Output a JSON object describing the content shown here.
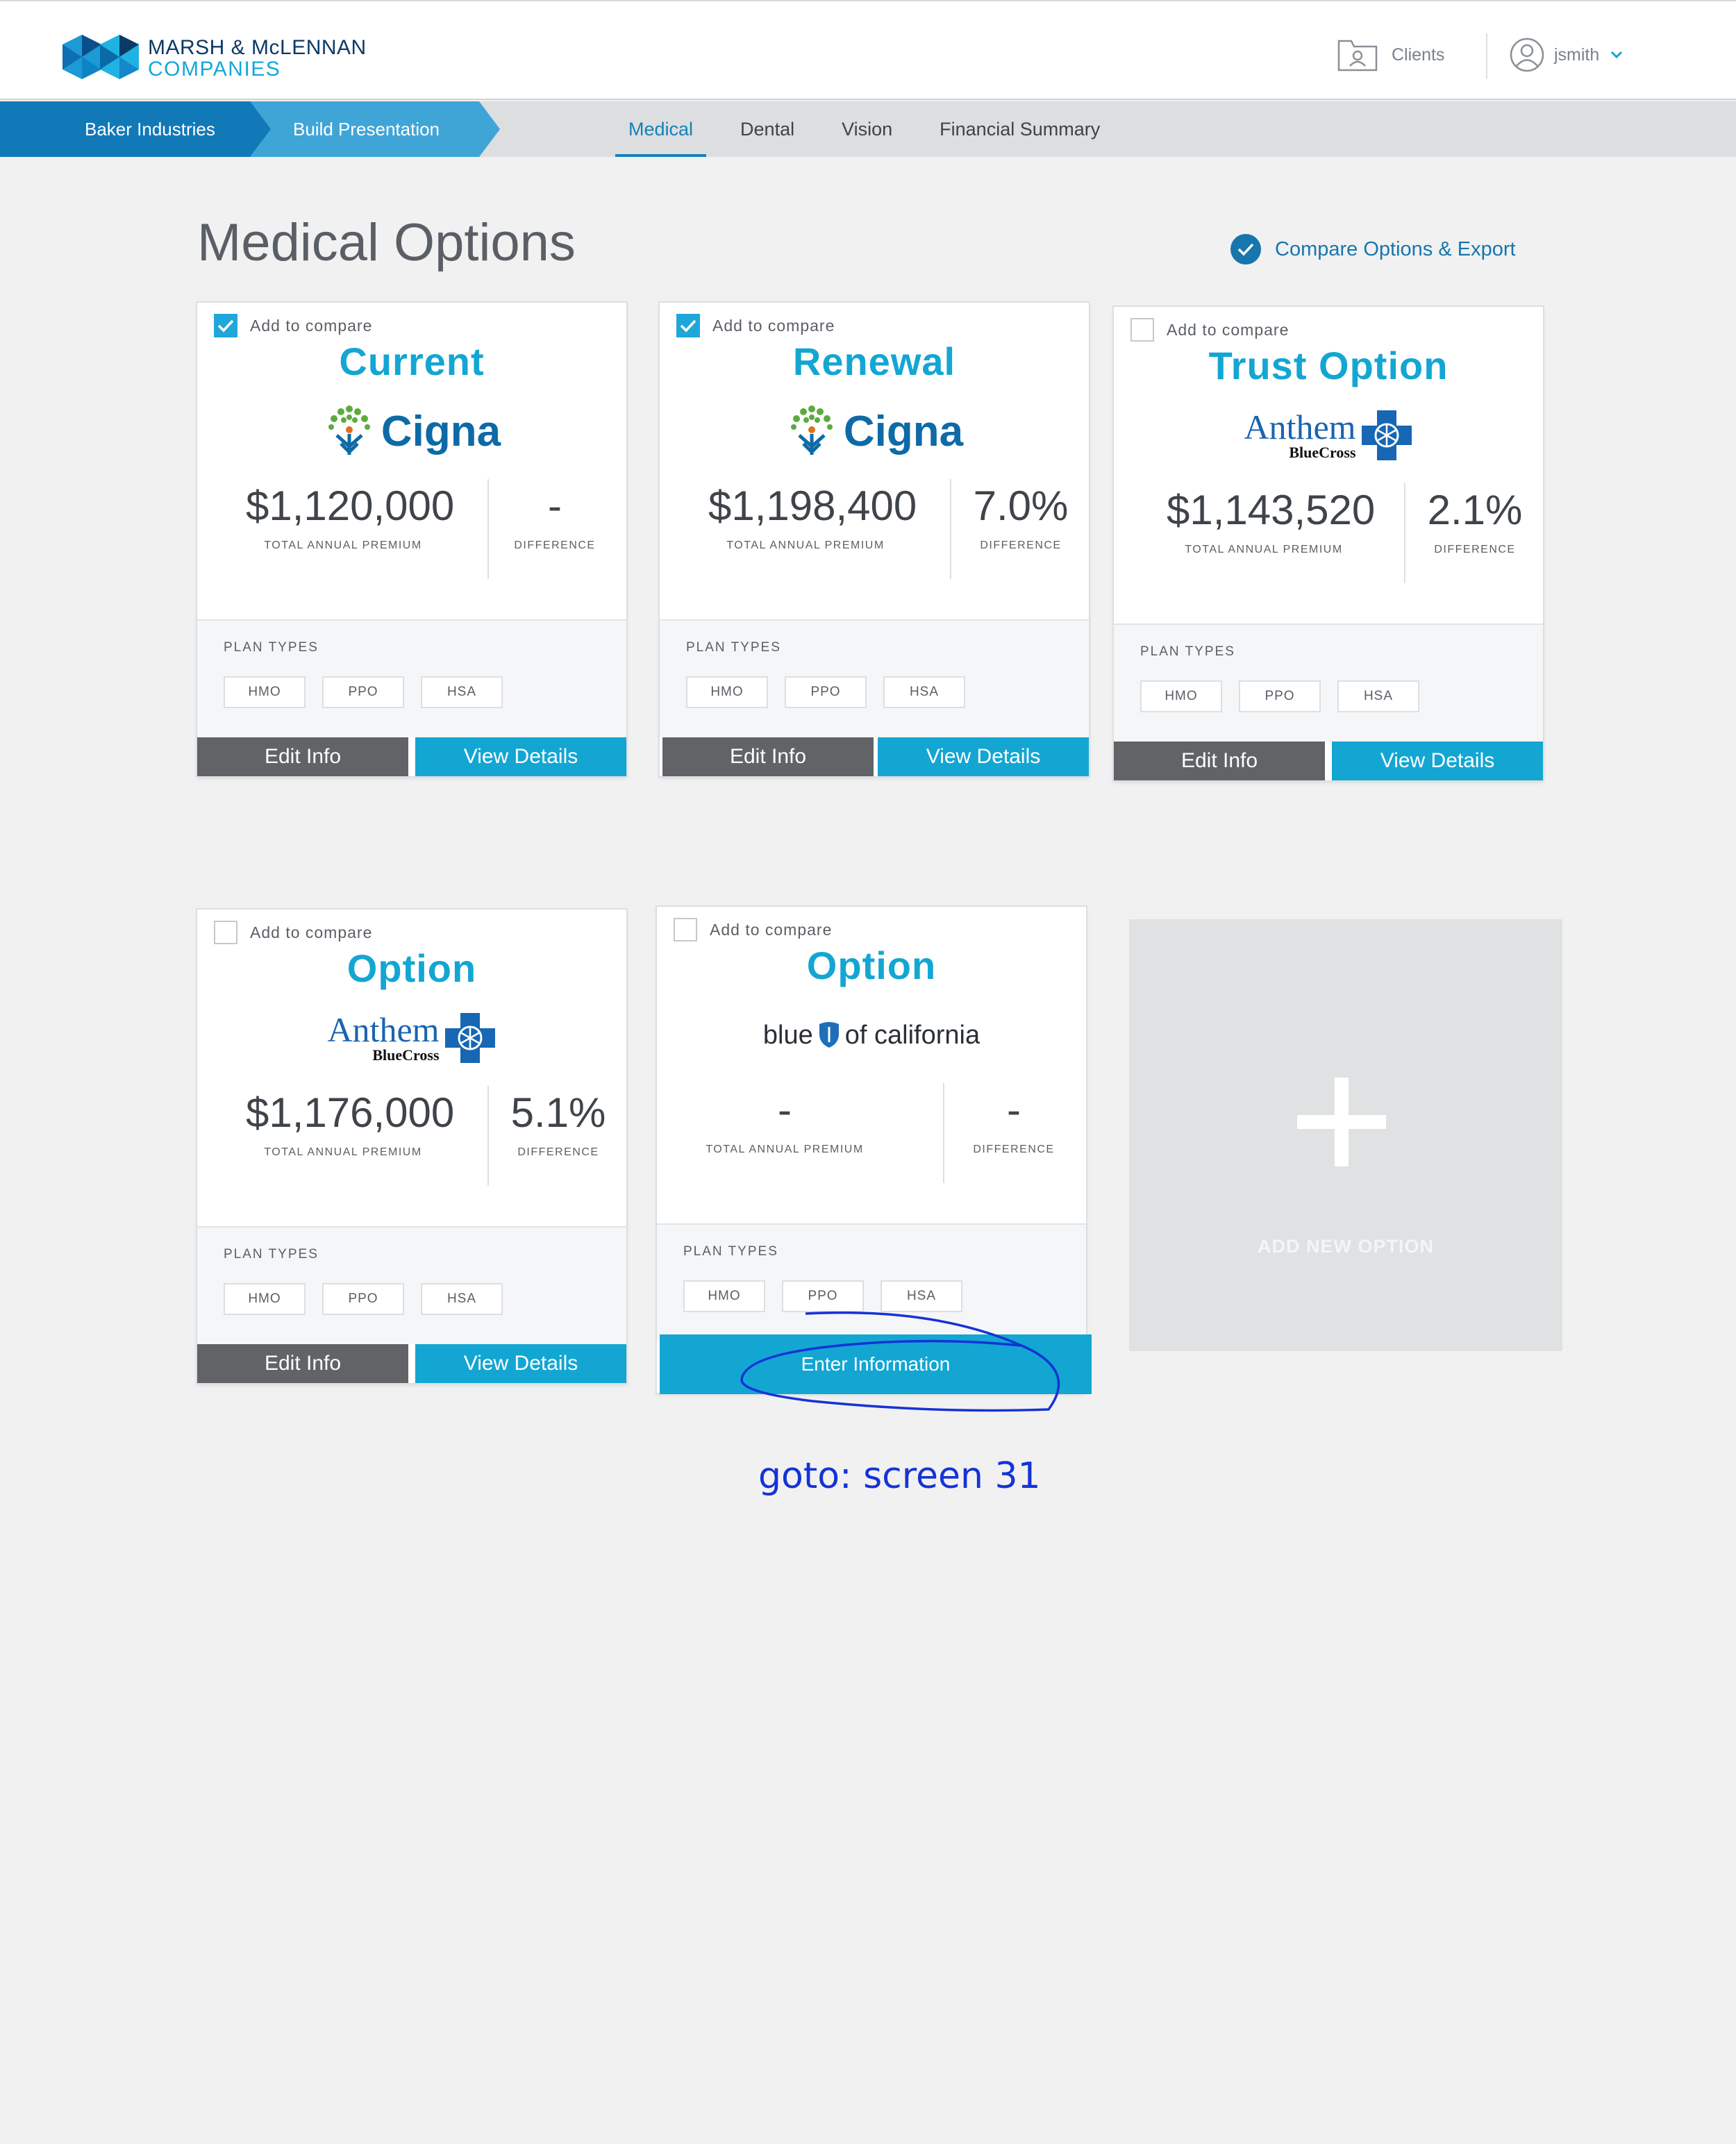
{
  "header": {
    "logo_line1": "MARSH & McLENNAN",
    "logo_line2": "COMPANIES",
    "clients_label": "Clients",
    "user_name": "jsmith"
  },
  "breadcrumb": {
    "items": [
      "Baker Industries",
      "Build Presentation"
    ]
  },
  "tabs": [
    {
      "label": "Medical",
      "active": true
    },
    {
      "label": "Dental",
      "active": false
    },
    {
      "label": "Vision",
      "active": false
    },
    {
      "label": "Financial Summary",
      "active": false
    }
  ],
  "page": {
    "title": "Medical Options",
    "compare_link": "Compare Options & Export"
  },
  "cards": [
    {
      "compare_label": "Add to compare",
      "checked": true,
      "title": "Current",
      "carrier": "Cigna",
      "premium": "$1,120,000",
      "premium_label": "TOTAL ANNUAL PREMIUM",
      "difference": "-",
      "difference_label": "DIFFERENCE",
      "plan_types_label": "PLAN TYPES",
      "plan_types": [
        "HMO",
        "PPO",
        "HSA"
      ],
      "edit_label": "Edit Info",
      "view_label": "View Details"
    },
    {
      "compare_label": "Add to compare",
      "checked": true,
      "title": "Renewal",
      "carrier": "Cigna",
      "premium": "$1,198,400",
      "premium_label": "TOTAL ANNUAL PREMIUM",
      "difference": "7.0%",
      "difference_label": "DIFFERENCE",
      "plan_types_label": "PLAN TYPES",
      "plan_types": [
        "HMO",
        "PPO",
        "HSA"
      ],
      "edit_label": "Edit Info",
      "view_label": "View Details"
    },
    {
      "compare_label": "Add to compare",
      "checked": false,
      "title": "Trust Option",
      "carrier": "Anthem",
      "carrier_sub": "BlueCross",
      "premium": "$1,143,520",
      "premium_label": "TOTAL ANNUAL PREMIUM",
      "difference": "2.1%",
      "difference_label": "DIFFERENCE",
      "plan_types_label": "PLAN TYPES",
      "plan_types": [
        "HMO",
        "PPO",
        "HSA"
      ],
      "edit_label": "Edit Info",
      "view_label": "View Details"
    },
    {
      "compare_label": "Add to compare",
      "checked": false,
      "title": "Option",
      "carrier": "Anthem",
      "carrier_sub": "BlueCross",
      "premium": "$1,176,000",
      "premium_label": "TOTAL ANNUAL PREMIUM",
      "difference": "5.1%",
      "difference_label": "DIFFERENCE",
      "plan_types_label": "PLAN TYPES",
      "plan_types": [
        "HMO",
        "PPO",
        "HSA"
      ],
      "edit_label": "Edit Info",
      "view_label": "View Details"
    },
    {
      "compare_label": "Add to compare",
      "checked": false,
      "title": "Option",
      "carrier_a": "blue",
      "carrier_b": "of california",
      "premium": "-",
      "premium_label": "TOTAL ANNUAL PREMIUM",
      "difference": "-",
      "difference_label": "DIFFERENCE",
      "plan_types_label": "PLAN TYPES",
      "plan_types": [
        "HMO",
        "PPO",
        "HSA"
      ],
      "enter_label": "Enter Information"
    }
  ],
  "add_option_label": "ADD NEW OPTION",
  "annotation": "goto: screen 31",
  "colors": {
    "brand_blue": "#13a6d3",
    "link_blue": "#1676ad",
    "button_gray": "#616366",
    "annotation_blue": "#1433d6"
  }
}
